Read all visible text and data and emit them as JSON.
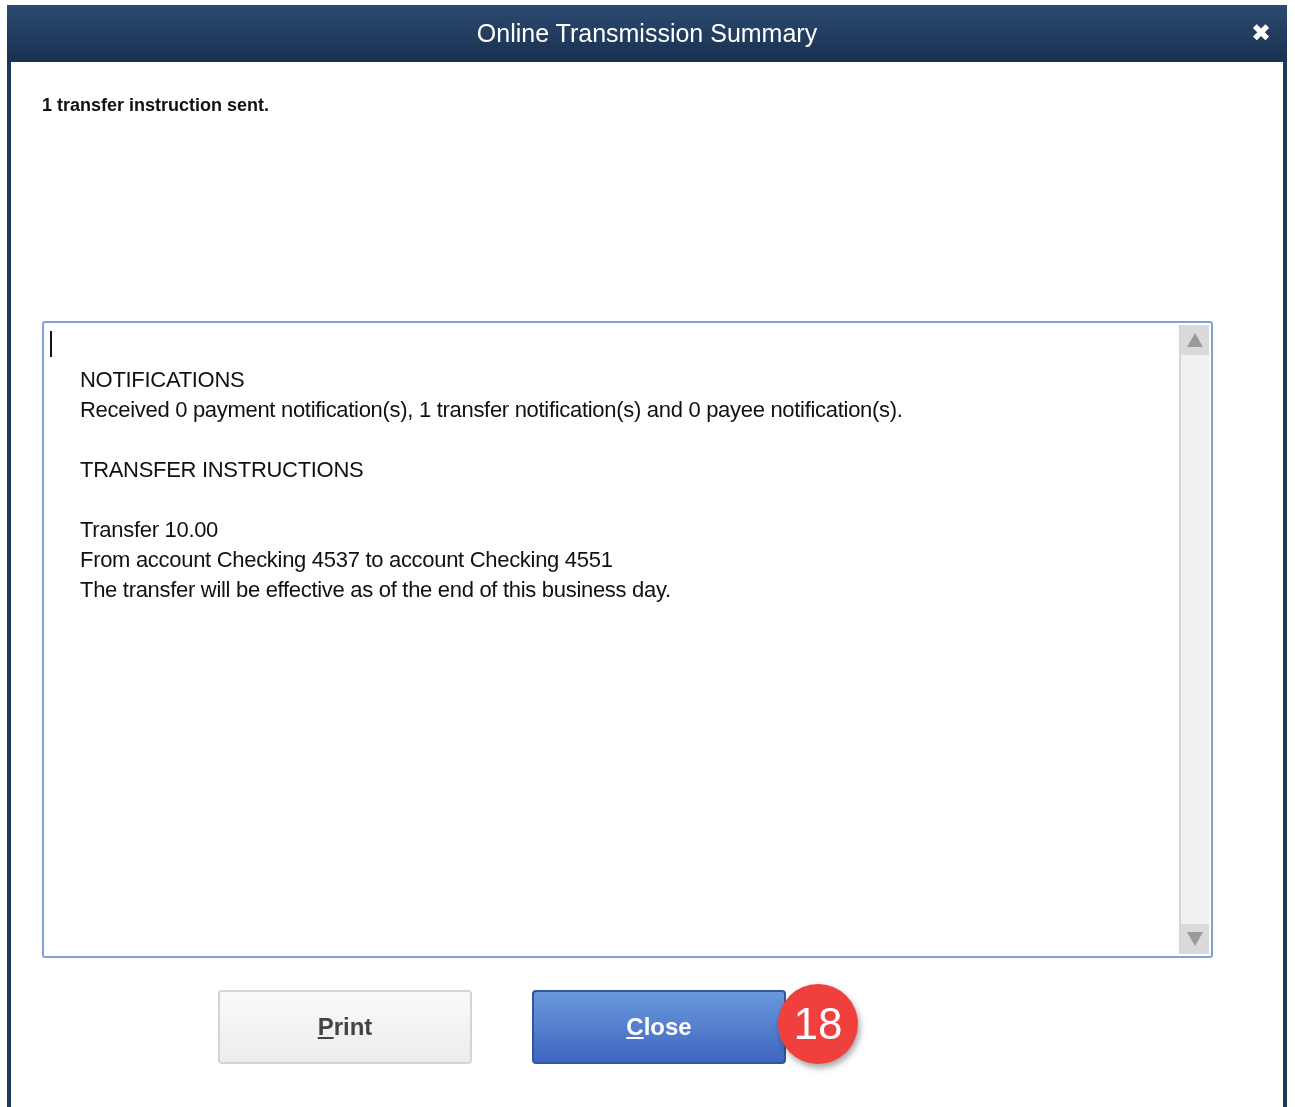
{
  "window": {
    "title": "Online Transmission Summary",
    "close_glyph": "✖"
  },
  "status_message": "1 transfer instruction sent.",
  "summary": {
    "cursor": true,
    "sections": [
      {
        "lines": [
          "NOTIFICATIONS",
          "Received 0 payment notification(s), 1 transfer notification(s) and 0 payee notification(s)."
        ]
      },
      {
        "lines": [
          "TRANSFER INSTRUCTIONS"
        ]
      },
      {
        "lines": [
          "Transfer 10.00",
          "From account Checking 4537 to account Checking 4551",
          "The transfer will be effective as of the end of this business day."
        ]
      }
    ]
  },
  "buttons": [
    {
      "label": "Print",
      "kind": "secondary",
      "mnemonic_underlined": true
    },
    {
      "label": "Close",
      "kind": "primary",
      "mnemonic_underlined": true,
      "badge": "18"
    }
  ]
}
